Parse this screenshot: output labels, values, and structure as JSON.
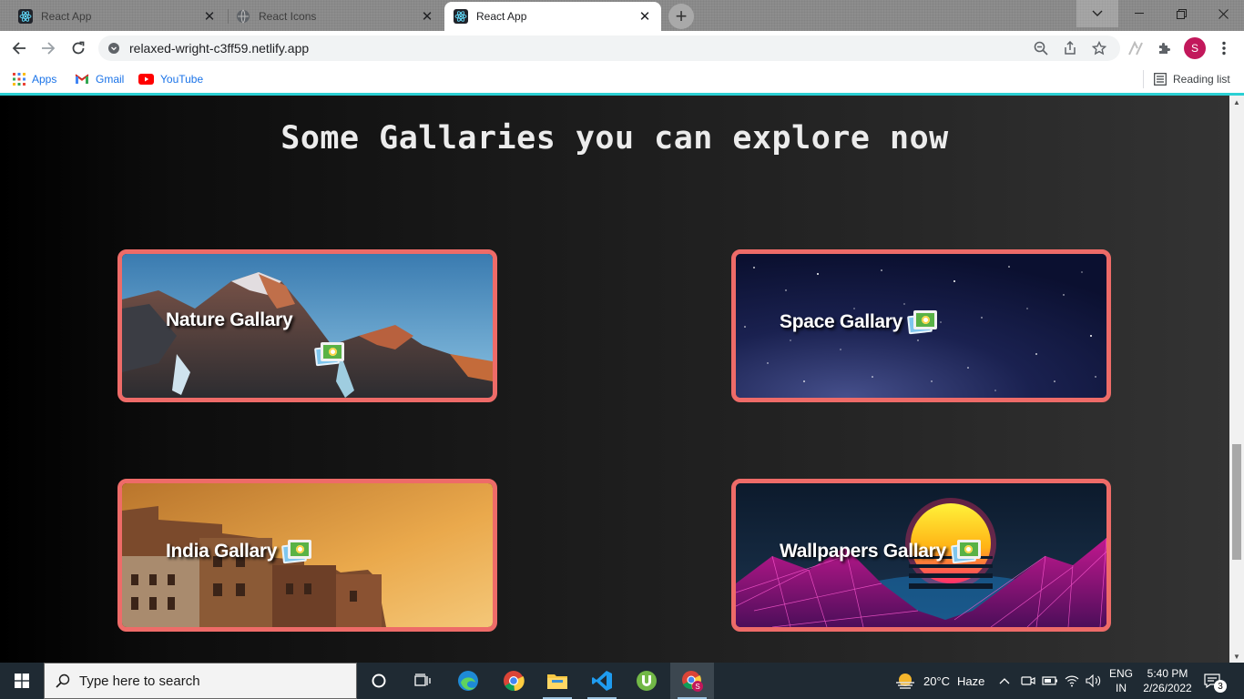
{
  "browser": {
    "tabs": [
      {
        "title": "React App",
        "favicon": "react-icon",
        "active": false
      },
      {
        "title": "React Icons",
        "favicon": "globe-icon",
        "active": false
      },
      {
        "title": "React App",
        "favicon": "react-icon",
        "active": true
      }
    ],
    "address_bar": {
      "url": "relaxed-wright-c3ff59.netlify.app"
    },
    "profile_initial": "S",
    "bookmarks": [
      {
        "label": "Apps",
        "icon": "apps-grid-icon"
      },
      {
        "label": "Gmail",
        "icon": "gmail-icon"
      },
      {
        "label": "YouTube",
        "icon": "youtube-icon"
      }
    ],
    "reading_list": "Reading list"
  },
  "page": {
    "heading": "Some Gallaries you can explore now",
    "galleries": [
      {
        "label": "Nature Gallary",
        "icon": "framed-picture-icon"
      },
      {
        "label": "Space Gallary",
        "icon": "framed-picture-icon"
      },
      {
        "label": "India Gallary",
        "icon": "framed-picture-icon"
      },
      {
        "label": "Wallpapers Gallary",
        "icon": "framed-picture-icon"
      }
    ],
    "accent_color": "#ee6b68"
  },
  "taskbar": {
    "search_placeholder": "Type here to search",
    "weather": {
      "temp": "20°C",
      "condition": "Haze"
    },
    "language": {
      "line1": "ENG",
      "line2": "IN"
    },
    "time": "5:40 PM",
    "date": "2/26/2022",
    "notifications": "3"
  }
}
